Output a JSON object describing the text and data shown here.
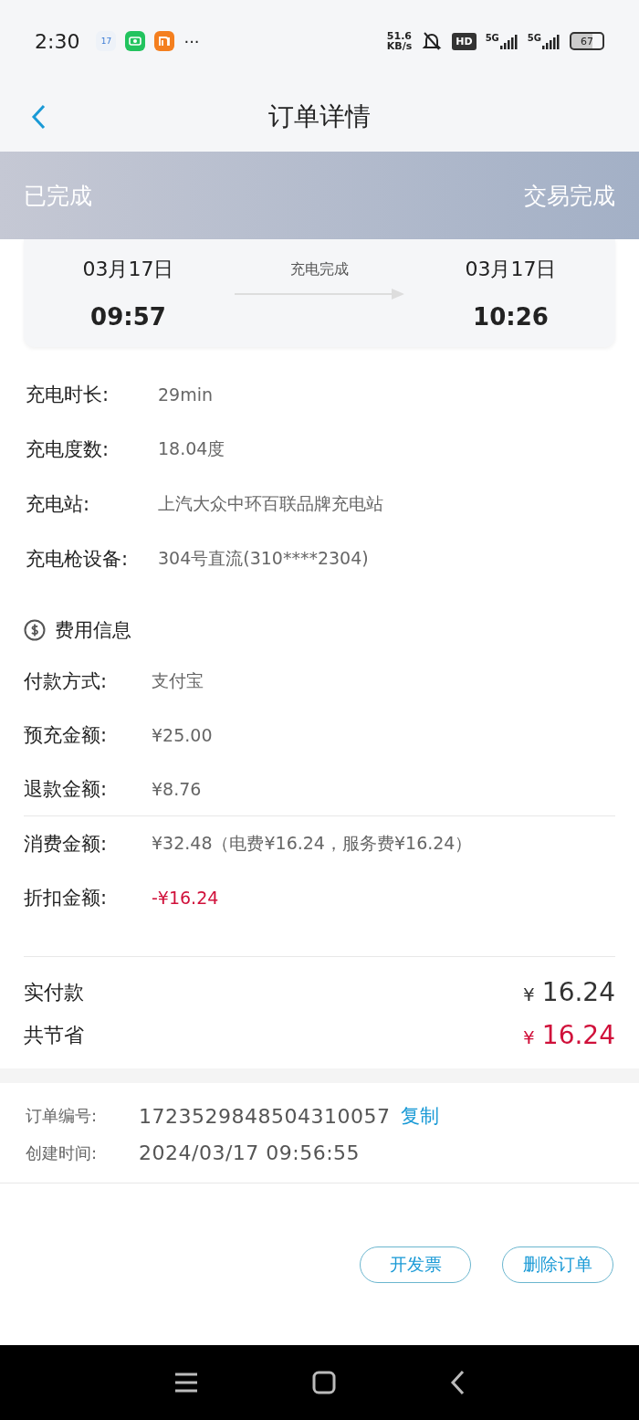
{
  "status_bar": {
    "time": "2:30",
    "calendar_day": "17",
    "more": "···",
    "net_speed": [
      "51.6",
      "KB/s"
    ],
    "hd": "HD",
    "networks": [
      "5G",
      "5G"
    ],
    "battery": "67"
  },
  "nav": {
    "title": "订单详情"
  },
  "banner": {
    "status": "已完成",
    "result": "交易完成"
  },
  "timing": {
    "start_date": "03月17日",
    "start_time": "09:57",
    "label": "充电完成",
    "end_date": "03月17日",
    "end_time": "10:26"
  },
  "details": [
    {
      "label": "充电时长:",
      "value": "29min"
    },
    {
      "label": "充电度数:",
      "value": "18.04度"
    },
    {
      "label": "充电站:",
      "value": "上汽大众中环百联品牌充电站"
    },
    {
      "label": "充电枪设备:",
      "value": "304号直流(310****2304)"
    }
  ],
  "fees": {
    "title": "费用信息",
    "rows": [
      {
        "label": "付款方式:",
        "value": "支付宝",
        "highlight": false,
        "divider_before": false
      },
      {
        "label": "预充金额:",
        "value": "¥25.00",
        "highlight": false,
        "divider_before": false
      },
      {
        "label": "退款金额:",
        "value": "¥8.76",
        "highlight": false,
        "divider_before": false
      },
      {
        "label": "消费金额:",
        "value": "¥32.48（电费¥16.24，服务费¥16.24）",
        "highlight": false,
        "divider_before": true
      },
      {
        "label": "折扣金额:",
        "value": "-¥16.24",
        "highlight": true,
        "divider_before": false
      }
    ]
  },
  "totals": [
    {
      "label": "实付款",
      "currency": "¥",
      "amount": "16.24",
      "highlight": false
    },
    {
      "label": "共节省",
      "currency": "¥",
      "amount": "16.24",
      "highlight": true
    }
  ],
  "order_info": [
    {
      "label": "订单编号:",
      "value": "1723529848504310057",
      "action": "复制"
    },
    {
      "label": "创建时间:",
      "value": "2024/03/17 09:56:55"
    }
  ],
  "buttons": [
    "开发票",
    "删除订单"
  ]
}
